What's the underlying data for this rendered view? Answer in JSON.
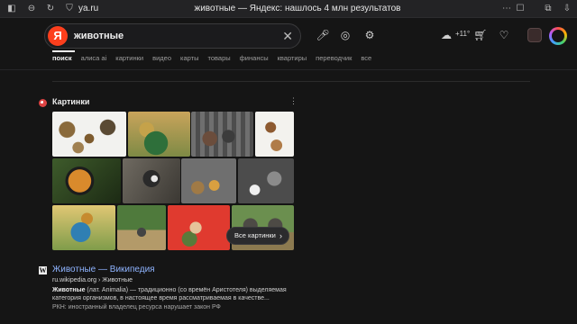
{
  "browser": {
    "url": "ya.ru",
    "tab_title": "животные — Яндекс: нашлось 4 млн результатов"
  },
  "search": {
    "logo": "Я",
    "query": "животные"
  },
  "header": {
    "weather_temp": "+11°"
  },
  "tabs": [
    "поиск",
    "алиса ai",
    "картинки",
    "видео",
    "карты",
    "товары",
    "финансы",
    "квартиры",
    "переводчик",
    "все"
  ],
  "images": {
    "title": "Картинки",
    "all_button": "Все картинки",
    "thumbnails": [
      "animals chart",
      "animals group",
      "zoo animals",
      "farm animals",
      "tiger",
      "raccoon",
      "animal set",
      "farm & wild animals",
      "animals on globe",
      "elephants & zebras",
      "animals collage",
      "african animals"
    ]
  },
  "result": {
    "favicon": "W",
    "title_bold": "Животные",
    "title_rest": " — Википедия",
    "url_domain": "ru.wikipedia.org",
    "url_path": " › Животные",
    "snippet_bold": "Животные",
    "snippet_rest": " (лат. Animalia) — традиционно (со времён Аристотеля) выделяемая категория организмов, в настоящее время рассматриваемая в качестве...",
    "note": "РКН: иностранный владелец ресурса нарушает закон РФ"
  },
  "colors": {
    "background": "#151515",
    "brand": "#fc3f1d",
    "link": "#8fb4ff"
  }
}
